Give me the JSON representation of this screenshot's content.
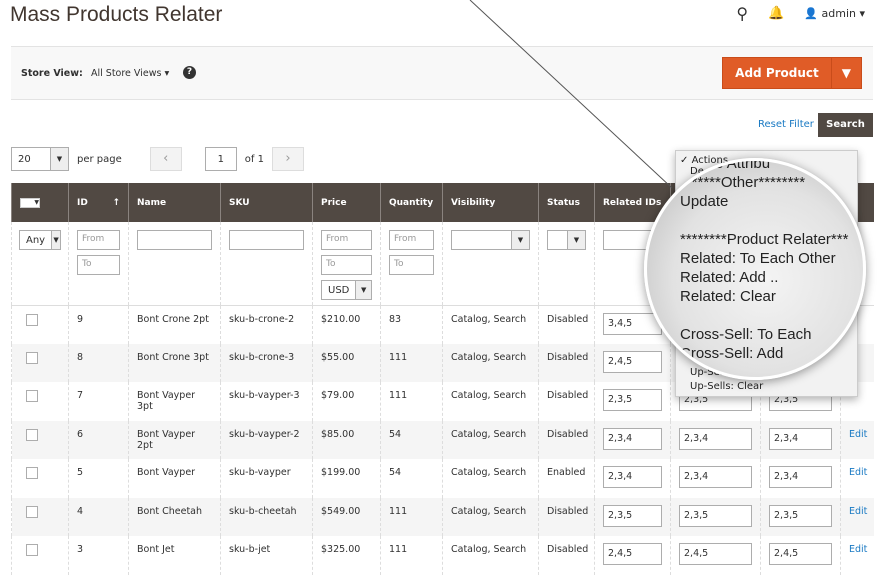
{
  "title": "Mass Products Relater",
  "header": {
    "user": "admin"
  },
  "store_view": {
    "label": "Store View:",
    "value": "All Store Views"
  },
  "add_product": "Add Product",
  "reset_filter": "Reset Filter",
  "search": "Search",
  "pager": {
    "per_page_value": "20",
    "per_page_label": "per page",
    "page": "1",
    "of": "of 1"
  },
  "columns": [
    "ID",
    "Name",
    "SKU",
    "Price",
    "Quantity",
    "Visibility",
    "Status",
    "Related IDs"
  ],
  "filters": {
    "any": "Any",
    "from": "From",
    "to": "To",
    "currency": "USD"
  },
  "rows": [
    {
      "id": "9",
      "name": "Bont Crone 2pt",
      "sku": "sku-b-crone-2",
      "price": "$210.00",
      "qty": "83",
      "vis": "Catalog, Search",
      "status": "Disabled",
      "rel": "3,4,5",
      "cross": "",
      "up": "",
      "edit": ""
    },
    {
      "id": "8",
      "name": "Bont Crone 3pt",
      "sku": "sku-b-crone-3",
      "price": "$55.00",
      "qty": "111",
      "vis": "Catalog, Search",
      "status": "Disabled",
      "rel": "2,4,5",
      "cross": "",
      "up": "",
      "edit": ""
    },
    {
      "id": "7",
      "name": "Bont Vayper 3pt",
      "sku": "sku-b-vayper-3",
      "price": "$79.00",
      "qty": "111",
      "vis": "Catalog, Search",
      "status": "Disabled",
      "rel": "2,3,5",
      "cross": "2,3,5",
      "up": "2,3,5",
      "edit": ""
    },
    {
      "id": "6",
      "name": "Bont Vayper 2pt",
      "sku": "sku-b-vayper-2",
      "price": "$85.00",
      "qty": "54",
      "vis": "Catalog, Search",
      "status": "Disabled",
      "rel": "2,3,4",
      "cross": "2,3,4",
      "up": "2,3,4",
      "edit": "Edit"
    },
    {
      "id": "5",
      "name": "Bont Vayper",
      "sku": "sku-b-vayper",
      "price": "$199.00",
      "qty": "54",
      "vis": "Catalog, Search",
      "status": "Enabled",
      "rel": "2,3,4",
      "cross": "2,3,4",
      "up": "2,3,4",
      "edit": "Edit"
    },
    {
      "id": "4",
      "name": "Bont Cheetah",
      "sku": "sku-b-cheetah",
      "price": "$549.00",
      "qty": "111",
      "vis": "Catalog, Search",
      "status": "Disabled",
      "rel": "2,3,5",
      "cross": "2,3,5",
      "up": "2,3,5",
      "edit": "Edit"
    },
    {
      "id": "3",
      "name": "Bont Jet",
      "sku": "sku-b-jet",
      "price": "$325.00",
      "qty": "111",
      "vis": "Catalog, Search",
      "status": "Disabled",
      "rel": "2,4,5",
      "cross": "2,4,5",
      "up": "2,4,5",
      "edit": "Edit"
    }
  ],
  "actions_menu": {
    "selected": "Actions",
    "items_small_top": [
      "De"
    ],
    "items_small_bottom": [
      "Up-Sells: Add ..",
      "Up-Sells: Clear"
    ]
  },
  "magnifier": [
    "Delete Attribu",
    "*******Other********",
    "Update",
    "",
    "********Product Relater***",
    "Related: To Each Other",
    "Related: Add ..",
    "Related: Clear",
    "",
    "Cross-Sell: To Each",
    "Cross-Sell: Add"
  ],
  "colors": {
    "accent": "#e05c27",
    "header": "#514943",
    "link": "#1979c3"
  }
}
